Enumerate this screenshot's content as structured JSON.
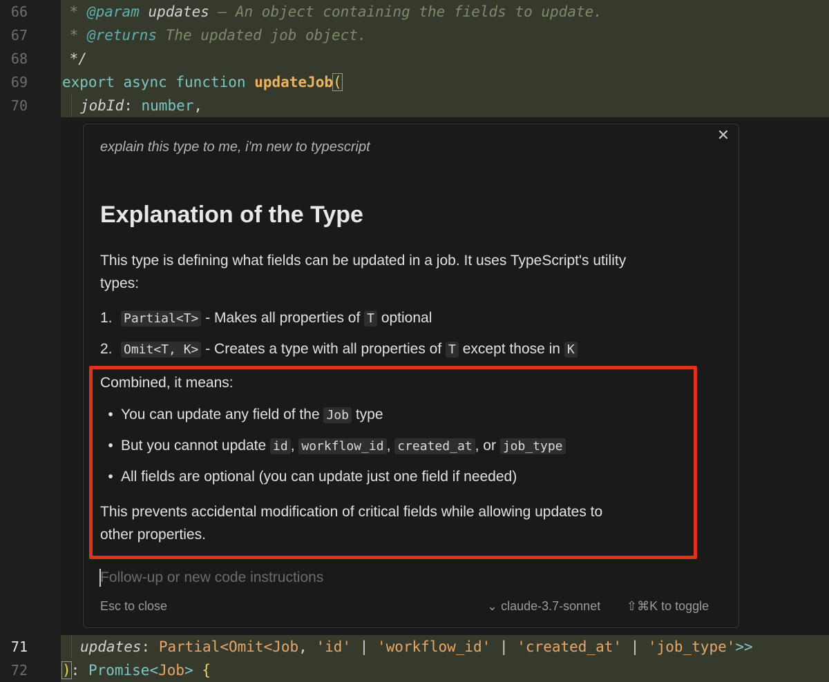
{
  "editor": {
    "lines": [
      {
        "n": "66"
      },
      {
        "n": "67"
      },
      {
        "n": "68"
      },
      {
        "n": "69"
      },
      {
        "n": "70"
      },
      {
        "n": "71"
      },
      {
        "n": "72"
      }
    ],
    "l66": {
      "star": " * ",
      "tag": "@param",
      "name": " updates",
      "text": " — An object containing the fields to update."
    },
    "l67": {
      "star": " * ",
      "tag": "@returns",
      "text": " The updated job object."
    },
    "l68": {
      "text": " */"
    },
    "l69": {
      "kw1": "export",
      "kw2": "async",
      "kw3": "function",
      "fn": "updateJob",
      "paren": "("
    },
    "l70": {
      "param": "jobId",
      "colon": ": ",
      "type": "number",
      "comma": ","
    },
    "l71": {
      "param": "updates",
      "colon": ": ",
      "t1": "Partial",
      "lt1": "<",
      "t2": "Omit",
      "lt2": "<",
      "t3": "Job",
      "s1": "'id'",
      "s2": "'workflow_id'",
      "s3": "'created_at'",
      "s4": "'job_type'",
      "gt": ">>",
      "comma": ", ",
      "pipe": " | "
    },
    "l72": {
      "paren": ")",
      "colon": ": ",
      "type": "Promise",
      "lt": "<",
      "t": "Job",
      "gt": ">",
      "brace": "{"
    }
  },
  "panel": {
    "prompt": "explain this type to me, i'm new to typescript",
    "heading": "Explanation of the Type",
    "intro_line1": "This type is defining what fields can be updated in a job. It uses TypeScript's utility",
    "intro_line2": "types:",
    "list": [
      {
        "num": "1.",
        "code": "Partial<T>",
        "t1": " - Makes all properties of ",
        "code2": "T",
        "t2": " optional"
      },
      {
        "num": "2.",
        "code": "Omit<T, K>",
        "t1": " - Creates a type with all properties of ",
        "code2": "T",
        "t2": " except those in ",
        "code3": "K"
      }
    ],
    "combined": "Combined, it means:",
    "bullets": {
      "b1_t1": "You can update any field of the ",
      "b1_code": "Job",
      "b1_t2": " type",
      "b2_t1": "But you cannot update ",
      "b2_c1": "id",
      "b2_sep1": ", ",
      "b2_c2": "workflow_id",
      "b2_sep2": ", ",
      "b2_c3": "created_at",
      "b2_sep3": ", or ",
      "b2_c4": "job_type",
      "b3": "All fields are optional (you can update just one field if needed)"
    },
    "bullet_glyph": "•",
    "outro_line1": "This prevents accidental modification of critical fields while allowing updates to",
    "outro_line2": "other properties.",
    "followup_placeholder": "Follow-up or new code instructions",
    "esc_hint": "Esc to close",
    "model_chevron": "⌄",
    "model": "claude-3.7-sonnet",
    "toggle_hint": "⇧⌘K to toggle",
    "close_glyph": "✕"
  },
  "colors": {
    "highlight_box": "#e0321d",
    "line_highlight": "#353a2c"
  }
}
